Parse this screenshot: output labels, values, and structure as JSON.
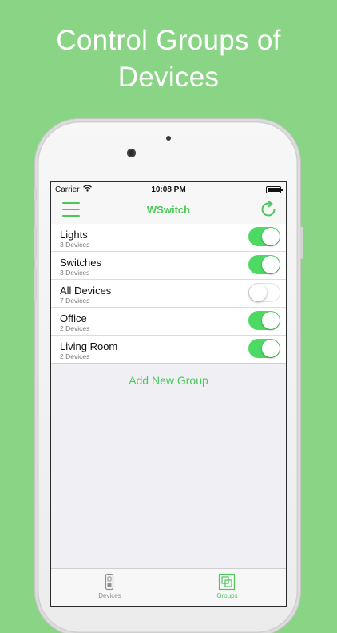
{
  "headline": {
    "line1": "Control Groups of",
    "line2": "Devices"
  },
  "colors": {
    "background": "#8ad486",
    "accent": "#4cc75a",
    "toggle_on": "#4cd964"
  },
  "status_bar": {
    "carrier": "Carrier",
    "time": "10:08 PM",
    "wifi_icon": "wifi-icon",
    "battery_icon": "battery-icon"
  },
  "nav": {
    "title": "WSwitch",
    "menu_icon": "hamburger-menu-icon",
    "refresh_icon": "refresh-icon"
  },
  "groups": [
    {
      "name": "Lights",
      "count": "3 Devices",
      "on": true
    },
    {
      "name": "Switches",
      "count": "3 Devices",
      "on": true
    },
    {
      "name": "All Devices",
      "count": "7 Devices",
      "on": false
    },
    {
      "name": "Office",
      "count": "2 Devices",
      "on": true
    },
    {
      "name": "Living Room",
      "count": "2 Devices",
      "on": true
    }
  ],
  "add_group_label": "Add New Group",
  "tabs": [
    {
      "label": "Devices",
      "icon": "device-icon",
      "active": false
    },
    {
      "label": "Groups",
      "icon": "groups-icon",
      "active": true
    }
  ]
}
